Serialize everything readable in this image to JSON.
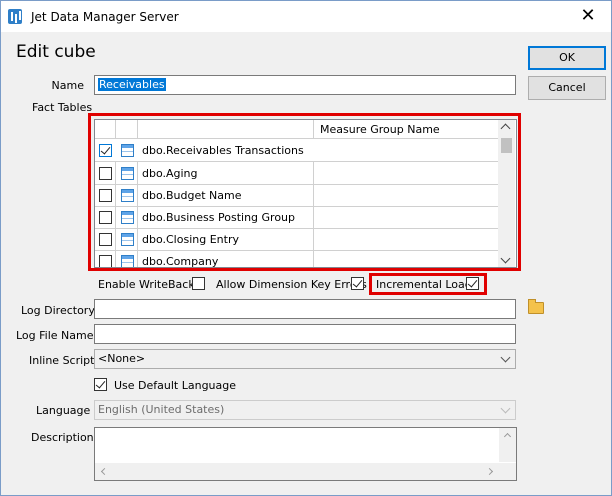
{
  "window": {
    "title": "Jet Data Manager Server",
    "close_glyph": "✕"
  },
  "heading": "Edit cube",
  "buttons": {
    "ok": "OK",
    "cancel": "Cancel"
  },
  "name": {
    "label": "Name",
    "value": "Receivables"
  },
  "fact_tables": {
    "label": "Fact Tables",
    "column_header": "Measure Group Name",
    "rows": [
      {
        "checked": true,
        "name": "dbo.Receivables Transactions",
        "measure_group": ""
      },
      {
        "checked": false,
        "name": "dbo.Aging",
        "measure_group": ""
      },
      {
        "checked": false,
        "name": "dbo.Budget Name",
        "measure_group": ""
      },
      {
        "checked": false,
        "name": "dbo.Business Posting Group",
        "measure_group": ""
      },
      {
        "checked": false,
        "name": "dbo.Closing Entry",
        "measure_group": ""
      },
      {
        "checked": false,
        "name": "dbo.Company",
        "measure_group": ""
      }
    ]
  },
  "options": {
    "enable_writeback": {
      "label": "Enable WriteBack",
      "checked": false
    },
    "allow_dim_key_errors": {
      "label": "Allow Dimension Key Errors",
      "checked": true
    },
    "incremental_load": {
      "label": "Incremental Load",
      "checked": true
    }
  },
  "log_directory": {
    "label": "Log Directory",
    "value": ""
  },
  "log_file_name": {
    "label": "Log File Name",
    "value": ""
  },
  "inline_script": {
    "label": "Inline Script",
    "value": "<None>"
  },
  "use_default_language": {
    "label": "Use Default Language",
    "checked": true
  },
  "language": {
    "label": "Language",
    "value": "English (United States)"
  },
  "description": {
    "label": "Description",
    "value": ""
  },
  "colors": {
    "highlight": "#e00000",
    "selection": "#0078d7",
    "accent_border": "#0078d7"
  }
}
